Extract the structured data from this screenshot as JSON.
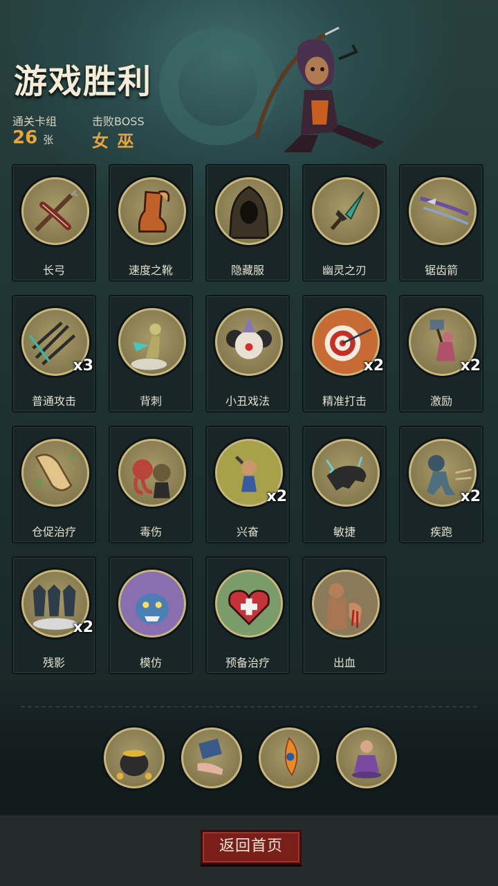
{
  "header": {
    "title": "游戏胜利",
    "cleared_label": "通关卡组",
    "cleared_count": "26",
    "cleared_unit": "张",
    "boss_label": "击败BOSS",
    "boss_name": "女 巫"
  },
  "cards": [
    {
      "name": "长弓",
      "icon": "longbow-icon",
      "mult": ""
    },
    {
      "name": "速度之靴",
      "icon": "boot-icon",
      "mult": ""
    },
    {
      "name": "隐藏服",
      "icon": "hood-icon",
      "mult": ""
    },
    {
      "name": "幽灵之刃",
      "icon": "ghost-blade-icon",
      "mult": ""
    },
    {
      "name": "锯齿箭",
      "icon": "serrated-arrow-icon",
      "mult": ""
    },
    {
      "name": "普通攻击",
      "icon": "arrows-icon",
      "mult": "x3"
    },
    {
      "name": "背刺",
      "icon": "backstab-icon",
      "mult": ""
    },
    {
      "name": "小丑戏法",
      "icon": "clown-icon",
      "mult": ""
    },
    {
      "name": "精准打击",
      "icon": "target-icon",
      "mult": "x2"
    },
    {
      "name": "激励",
      "icon": "hammer-warrior-icon",
      "mult": "x2"
    },
    {
      "name": "仓促治疗",
      "icon": "scroll-icon",
      "mult": ""
    },
    {
      "name": "毒伤",
      "icon": "octopus-icon",
      "mult": ""
    },
    {
      "name": "兴奋",
      "icon": "excited-dwarf-icon",
      "mult": "x2"
    },
    {
      "name": "敏捷",
      "icon": "panther-icon",
      "mult": ""
    },
    {
      "name": "疾跑",
      "icon": "running-beast-icon",
      "mult": "x2"
    },
    {
      "name": "残影",
      "icon": "afterimage-icon",
      "mult": "x2"
    },
    {
      "name": "模仿",
      "icon": "goblin-face-icon",
      "mult": ""
    },
    {
      "name": "预备治疗",
      "icon": "heart-icon",
      "mult": ""
    },
    {
      "name": "出血",
      "icon": "bleeding-icon",
      "mult": ""
    }
  ],
  "relics": [
    {
      "icon": "gold-pot-icon"
    },
    {
      "icon": "card-hand-icon"
    },
    {
      "icon": "feather-icon"
    },
    {
      "icon": "meditating-woman-icon"
    }
  ],
  "home_button": "返回首页",
  "colors": {
    "accent": "#e8a53c",
    "medal_rim": "#c8b77e",
    "button": "#7a1e1a"
  }
}
